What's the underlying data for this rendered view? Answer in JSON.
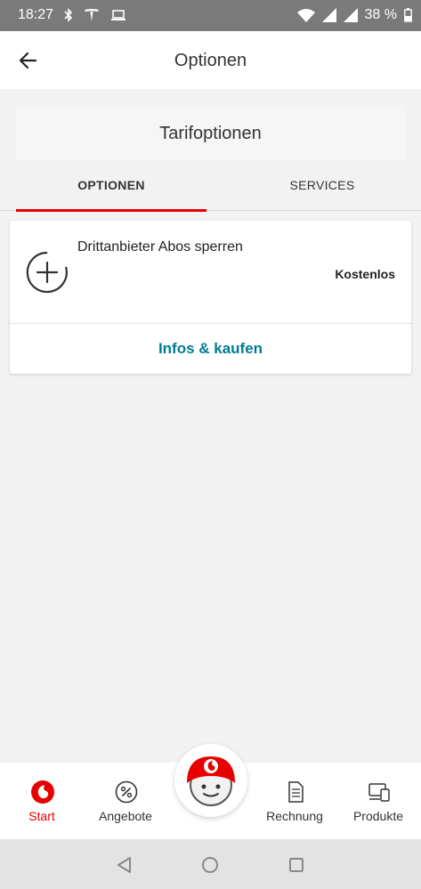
{
  "status_bar": {
    "time": "18:27",
    "battery": "38 %",
    "icons": [
      "bluetooth-icon",
      "tesla-icon",
      "laptop-icon",
      "wifi-icon",
      "signal-icon",
      "signal-icon",
      "battery-icon"
    ]
  },
  "app_bar": {
    "title": "Optionen",
    "back_icon": "back-arrow-icon"
  },
  "tarif_header": {
    "label": "Tarifoptionen"
  },
  "tabs": [
    {
      "label": "OPTIONEN",
      "active": true
    },
    {
      "label": "SERVICES",
      "active": false
    }
  ],
  "option": {
    "icon": "plus-circle-icon",
    "name": "Drittanbieter Abos sperren",
    "price": "Kostenlos",
    "action_label": "Infos & kaufen"
  },
  "bottom_nav": {
    "items": [
      {
        "label": "Start",
        "icon": "vodafone-logo-icon",
        "active": true
      },
      {
        "label": "Angebote",
        "icon": "percent-icon",
        "active": false
      },
      {
        "label": "Rechnung",
        "icon": "document-icon",
        "active": false
      },
      {
        "label": "Produkte",
        "icon": "devices-icon",
        "active": false
      }
    ],
    "center_icon": "tobi-assistant-icon"
  },
  "colors": {
    "accent_red": "#e60000",
    "link_teal": "#007c92",
    "status_bar": "#7a7a7a"
  }
}
